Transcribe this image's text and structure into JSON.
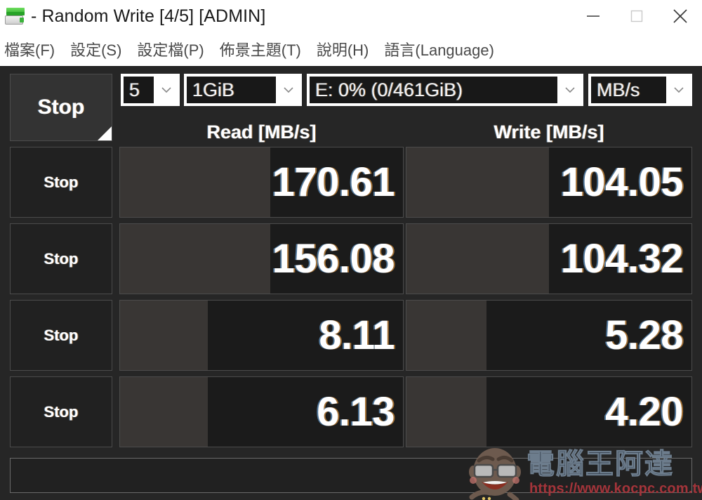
{
  "window": {
    "title": "- Random Write [4/5] [ADMIN]",
    "icon": "disk-icon",
    "controls": {
      "minimize": "minimize-icon",
      "maximize": "maximize-icon",
      "close": "close-icon"
    }
  },
  "menu": {
    "items": [
      {
        "label": "檔案(F)"
      },
      {
        "label": "設定(S)"
      },
      {
        "label": "設定檔(P)"
      },
      {
        "label": "佈景主題(T)"
      },
      {
        "label": "說明(H)"
      },
      {
        "label": "語言(Language)"
      }
    ]
  },
  "toolbar": {
    "all_button_label": "Stop",
    "count": {
      "value": "5",
      "label": "count-select"
    },
    "size": {
      "value": "1GiB",
      "label": "size-select"
    },
    "drive": {
      "value": "E: 0% (0/461GiB)",
      "label": "drive-select"
    },
    "unit": {
      "value": "MB/s",
      "label": "unit-select"
    }
  },
  "headers": {
    "read": "Read [MB/s]",
    "write": "Write [MB/s]"
  },
  "rows": [
    {
      "button": "Stop",
      "read": "170.61",
      "write": "104.05",
      "read_fill_pct": 53,
      "write_fill_pct": 50
    },
    {
      "button": "Stop",
      "read": "156.08",
      "write": "104.32",
      "read_fill_pct": 53,
      "write_fill_pct": 50
    },
    {
      "button": "Stop",
      "read": "8.11",
      "write": "5.28",
      "read_fill_pct": 31,
      "write_fill_pct": 28
    },
    {
      "button": "Stop",
      "read": "6.13",
      "write": "4.20",
      "read_fill_pct": 31,
      "write_fill_pct": 28
    }
  ],
  "status": {
    "text": ""
  },
  "watermark": {
    "brand": "電腦王阿達",
    "url": "https://www.kocpc.com.tw/"
  },
  "colors": {
    "background": "#262626",
    "titlebar": "#ffffff",
    "cell_empty": "#1b1b1b",
    "cell_fill": "#393634",
    "value_text": "#ffffff",
    "watermark_url": "#a4343a"
  }
}
